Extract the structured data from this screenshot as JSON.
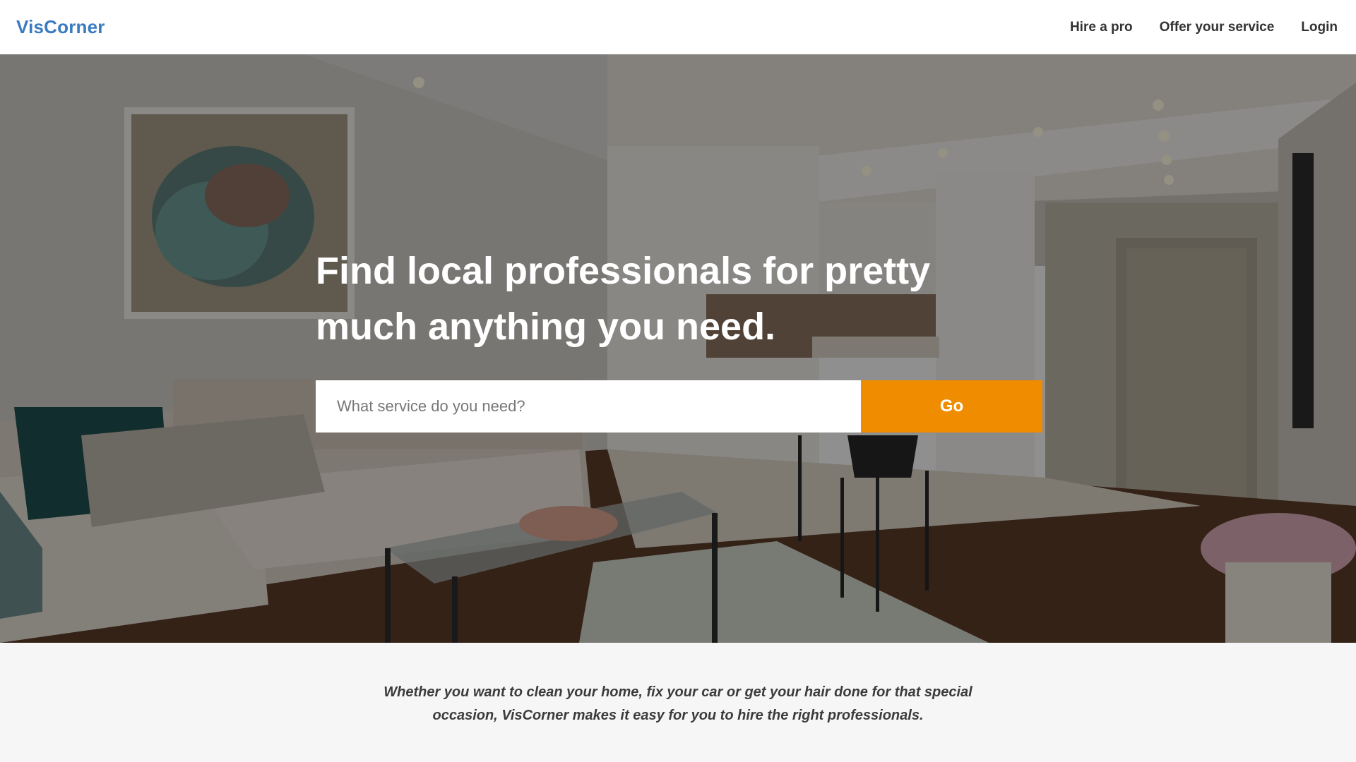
{
  "header": {
    "brand": "VisCorner",
    "nav": [
      {
        "label": "Hire a pro"
      },
      {
        "label": "Offer your service"
      },
      {
        "label": "Login"
      }
    ]
  },
  "hero": {
    "title": "Find local professionals for pretty much anything you need.",
    "search": {
      "placeholder": "What service do you need?",
      "value": ""
    },
    "go_label": "Go"
  },
  "intro": {
    "text": "Whether you want to clean your home, fix your car or get your hair done for that special occasion, VisCorner makes it easy for you to hire the right professionals."
  },
  "colors": {
    "brand": "#3a7bc0",
    "accent": "#ef8c00",
    "nav_text": "#333333",
    "intro_bg": "#f6f6f6"
  }
}
